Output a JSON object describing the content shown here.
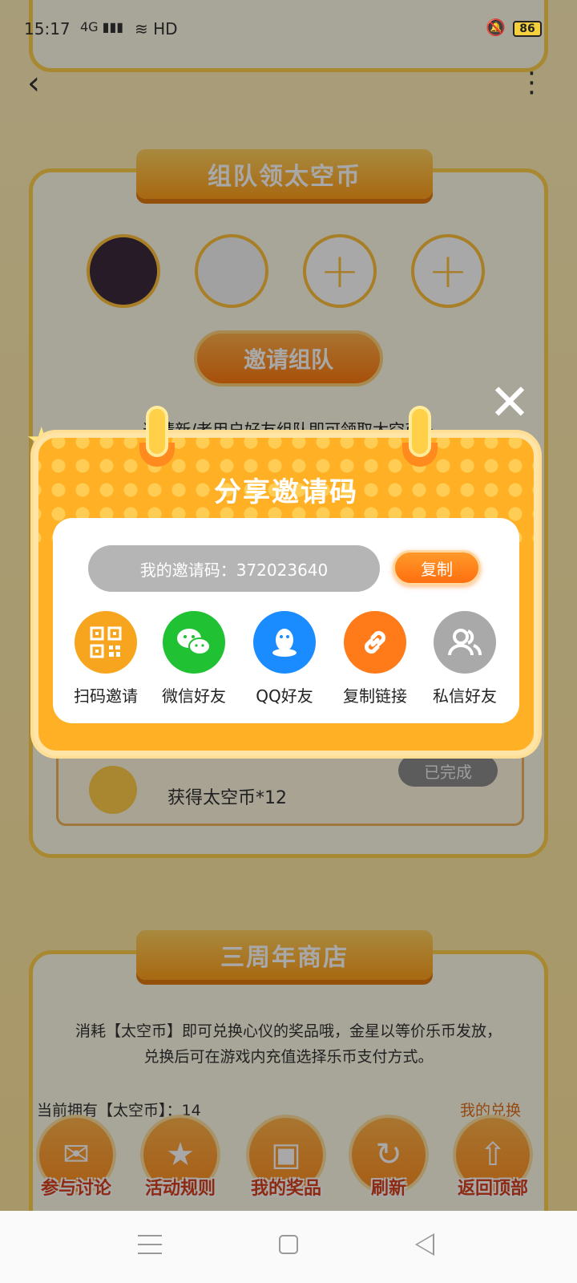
{
  "status_bar": {
    "time": "15:17",
    "network": "4G",
    "hd": "HD",
    "battery": "86"
  },
  "team_section": {
    "title": "组队领太空币",
    "invite_button": "邀请组队",
    "tip": "邀请新/老用户好友组队即可领取太空币~"
  },
  "task": {
    "reward_text": "获得太空币*12",
    "status": "已完成"
  },
  "shop_section": {
    "title": "三周年商店",
    "description_line1": "消耗【太空币】即可兑换心仪的奖品哦，金星以等价乐币发放，",
    "description_line2": "兑换后可在游戏内充值选择乐币支付方式。",
    "coins_text": "当前拥有【太空币】：14",
    "my_prizes_link": "我的兑换"
  },
  "bottom_bar": {
    "items": [
      {
        "label": "参与讨论",
        "icon": "chat-icon"
      },
      {
        "label": "活动规则",
        "icon": "rules-icon"
      },
      {
        "label": "我的奖品",
        "icon": "gift-icon"
      },
      {
        "label": "刷新",
        "icon": "refresh-icon"
      },
      {
        "label": "返回顶部",
        "icon": "back-to-top-icon"
      }
    ]
  },
  "modal": {
    "title": "分享邀请码",
    "code_label": "我的邀请码：372023640",
    "copy_button": "复制",
    "share_options": [
      {
        "label": "扫码邀请",
        "icon": "qr-code-icon",
        "color": "#f7a51f"
      },
      {
        "label": "微信好友",
        "icon": "wechat-icon",
        "color": "#20c133"
      },
      {
        "label": "QQ好友",
        "icon": "qq-icon",
        "color": "#1a8cff"
      },
      {
        "label": "复制链接",
        "icon": "link-icon",
        "color": "#ff7b1a"
      },
      {
        "label": "私信好友",
        "icon": "friends-icon",
        "color": "#a9a9a9"
      }
    ]
  },
  "colors": {
    "accent_orange": "#ffb025",
    "copy_button": "#ff7a10",
    "code_pill": "#b5b5b5"
  }
}
